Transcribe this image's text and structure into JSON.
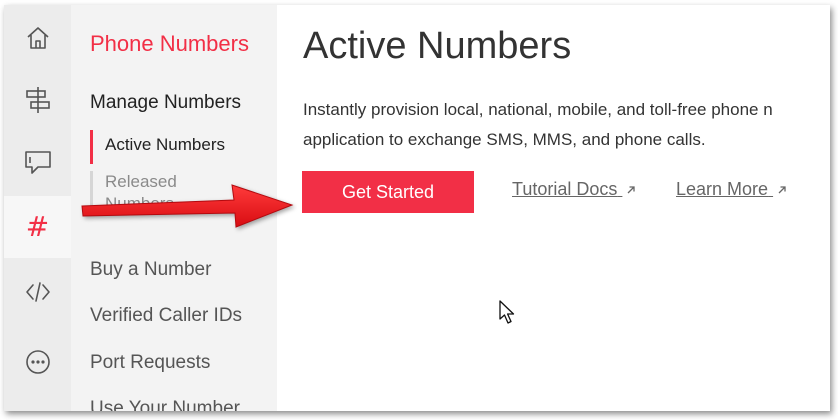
{
  "rail": {
    "items": [
      {
        "icon": "home-icon"
      },
      {
        "icon": "flow-icon"
      },
      {
        "icon": "chat-icon"
      },
      {
        "icon": "hash-icon",
        "glyph": "#",
        "active": true
      },
      {
        "icon": "code-icon"
      },
      {
        "icon": "more-icon"
      }
    ]
  },
  "subnav": {
    "title": "Phone Numbers",
    "section": "Manage Numbers",
    "sub_items": [
      "Active Numbers",
      "Released Numbers"
    ],
    "links": [
      "Buy a Number",
      "Verified Caller IDs",
      "Port Requests",
      "Use Your Number"
    ]
  },
  "main": {
    "title": "Active Numbers",
    "description_line1": "Instantly provision local, national, mobile, and toll-free phone n",
    "description_line2": "application to exchange SMS, MMS, and phone calls.",
    "cta_label": "Get Started",
    "links": [
      "Tutorial Docs",
      "Learn More"
    ]
  },
  "colors": {
    "brand_red": "#f22f46",
    "rail_bg": "#ececec",
    "subnav_bg": "#f3f3f3",
    "annotation_red": "#e8141b"
  }
}
